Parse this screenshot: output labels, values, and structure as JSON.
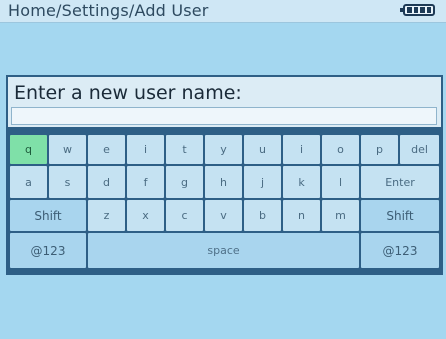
{
  "title_bar": {
    "breadcrumb": "Home/Settings/Add User",
    "battery_icon": "battery-full-icon",
    "battery_level": 1.0
  },
  "dialog": {
    "prompt": "Enter a new user name:",
    "input_value": ""
  },
  "keyboard": {
    "row1": [
      "q",
      "w",
      "e",
      "i",
      "t",
      "y",
      "u",
      "i",
      "o",
      "p",
      "del"
    ],
    "row2": [
      "a",
      "s",
      "d",
      "f",
      "g",
      "h",
      "j",
      "k",
      "l",
      "Enter"
    ],
    "row3": [
      "Shift",
      "z",
      "x",
      "c",
      "v",
      "b",
      "n",
      "m",
      "Shift"
    ],
    "row4": [
      "@123",
      "space",
      "@123"
    ]
  },
  "colors": {
    "background": "#a4d7f0",
    "title_bar": "#cfe7f5",
    "dialog_border": "#2e5f86",
    "key": "#c5e2f2",
    "key_active": "#7fe0a8"
  }
}
